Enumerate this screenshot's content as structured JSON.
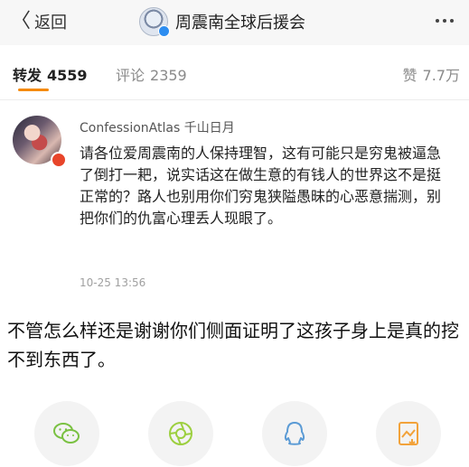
{
  "nav": {
    "back_label": "返回",
    "title": "周震南全球后援会"
  },
  "tabs": {
    "repost": {
      "label": "转发",
      "count": "4559"
    },
    "comment": {
      "label": "评论",
      "count": "2359"
    },
    "like": {
      "label": "赞",
      "count": "7.7万"
    }
  },
  "comment": {
    "username": "ConfessionAtlas 千山日月",
    "text": "请各位爱周震南的人保持理智，这有可能只是穷鬼被逼急了倒打一耙，说实话这在做生意的有钱人的世界这不是挺正常的？路人也别用你们穷鬼狭隘愚昧的心恶意揣测，别把你们的仇富心理丢人现眼了。",
    "timestamp": "10-25 13:56"
  },
  "caption": "不管怎么样还是谢谢你们侧面证明了这孩子身上是真的挖不到东西了。",
  "share": [
    {
      "icon": "wechat-icon",
      "color": "#7ac142"
    },
    {
      "icon": "moments-icon",
      "color": "#9ccf3f"
    },
    {
      "icon": "qq-icon",
      "color": "#5b9bd5"
    },
    {
      "icon": "save-image-icon",
      "color": "#f2a23a"
    }
  ]
}
